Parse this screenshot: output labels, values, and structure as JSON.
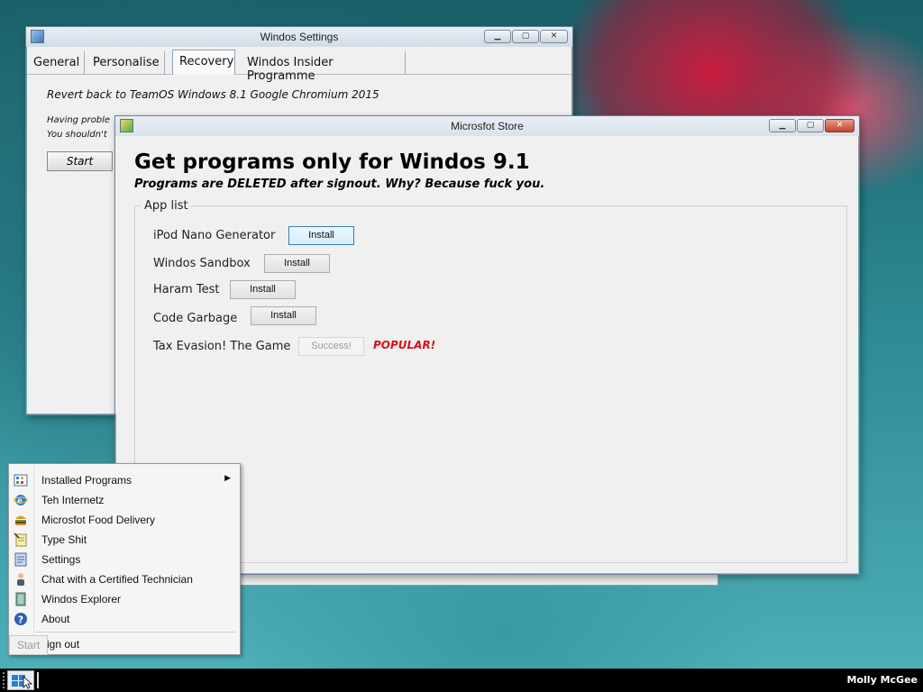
{
  "settings_window": {
    "title": "Windos Settings",
    "tabs": [
      "General",
      "Personalise",
      "Recovery",
      "Windos Insider Programme"
    ],
    "active_tab": "Recovery",
    "revert_text": "Revert back to TeamOS Windows 8.1 Google Chromium 2015",
    "trouble_line1": "Having proble",
    "trouble_line2": "You shouldn't",
    "start_button": "Start"
  },
  "store_window": {
    "title": "Microsfot Store",
    "heading": "Get programs only for Windos 9.1",
    "subheading": "Programs are DELETED after signout. Why? Because fuck you.",
    "group_label": "App list",
    "apps": [
      {
        "name": "iPod Nano Generator",
        "button": "Install"
      },
      {
        "name": "Windos Sandbox",
        "button": "Install"
      },
      {
        "name": "Haram Test",
        "button": "Install"
      },
      {
        "name": "Code Garbage",
        "button": "Install"
      },
      {
        "name": "Tax Evasion! The Game",
        "button": "Success!",
        "badge": "POPULAR!"
      }
    ]
  },
  "start_menu": {
    "items": [
      {
        "label": "Installed Programs",
        "icon": "programs-icon",
        "has_submenu": true
      },
      {
        "label": "Teh Internetz",
        "icon": "internet-explorer-icon"
      },
      {
        "label": "Microsfot Food Delivery",
        "icon": "burger-icon"
      },
      {
        "label": "Type Shit",
        "icon": "notepad-icon"
      },
      {
        "label": "Settings",
        "icon": "settings-icon"
      },
      {
        "label": "Chat with a Certified Technician",
        "icon": "technician-icon"
      },
      {
        "label": "Windos Explorer",
        "icon": "explorer-icon"
      },
      {
        "label": "About",
        "icon": "help-icon"
      }
    ],
    "signout_label": "ign out",
    "start_ghost_label": "Start"
  },
  "taskbar": {
    "user_name": "Molly McGee"
  },
  "colors": {
    "popular": "#d4121b",
    "close_button": "#c2432e",
    "taskbar": "#000000"
  }
}
